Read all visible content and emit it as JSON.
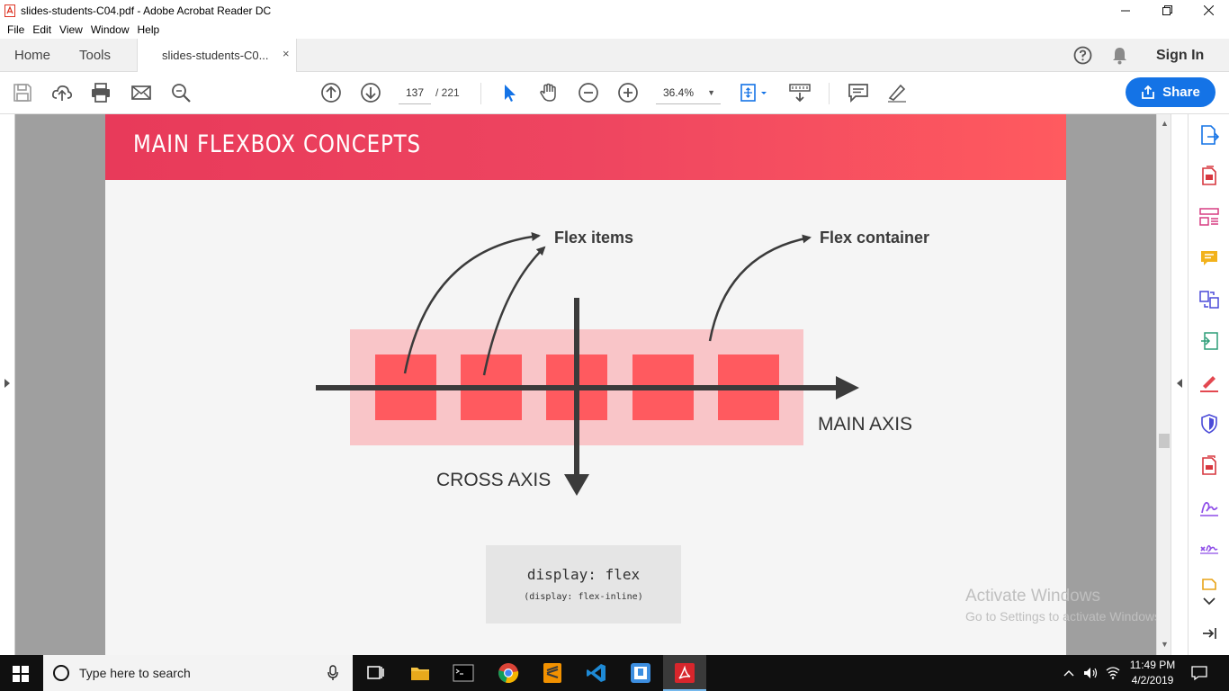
{
  "window": {
    "title": "slides-students-C04.pdf - Adobe Acrobat Reader DC",
    "controls": [
      "minimize",
      "restore",
      "close"
    ]
  },
  "menu": [
    "File",
    "Edit",
    "View",
    "Window",
    "Help"
  ],
  "tabs": {
    "home": "Home",
    "tools": "Tools",
    "document": "slides-students-C0...",
    "close_symbol": "×",
    "sign_in": "Sign In"
  },
  "toolbar": {
    "current_page": "137",
    "total_pages": "/ 221",
    "zoom": "36.4%",
    "share": "Share",
    "icons": [
      "save-icon",
      "upload-cloud-icon",
      "print-icon",
      "email-icon",
      "find-icon",
      "page-up-icon",
      "page-down-icon",
      "select-arrow-icon",
      "pan-hand-icon",
      "zoom-out-icon",
      "zoom-in-icon",
      "fit-page-icon",
      "read-mode-icon",
      "comment-icon",
      "sign-highlight-icon"
    ]
  },
  "slide": {
    "title": "MAIN FLEXBOX CONCEPTS",
    "flex_items_label": "Flex items",
    "flex_container_label": "Flex container",
    "main_axis_label": "MAIN AXIS",
    "cross_axis_label": "CROSS AXIS",
    "code_main": "display: flex",
    "code_sub": "(display: flex-inline)",
    "colors": {
      "header_start": "#e83a5a",
      "header_end": "#ff5a5f",
      "item": "#ff5a5f",
      "container": "#f9c5c8",
      "axis": "#3b3b3b"
    },
    "item_count": 5
  },
  "watermark": {
    "line1": "Activate Windows",
    "line2": "Go to Settings to activate Windows."
  },
  "right_panel_icons": [
    "export-pdf-icon",
    "create-pdf-icon",
    "organize-pages-icon",
    "comment-tool-icon",
    "combine-files-icon",
    "edit-pdf-icon",
    "fill-sign-icon",
    "protect-icon",
    "send-for-review-icon",
    "request-signature-icon",
    "certificates-icon",
    "more-tools-icon",
    "expand-chevron-icon",
    "collapse-panel-icon"
  ],
  "taskbar": {
    "search_placeholder": "Type here to search",
    "time": "11:49 PM",
    "date": "4/2/2019",
    "apps": [
      "task-view-icon",
      "file-explorer-icon",
      "terminal-icon",
      "chrome-icon",
      "sublime-icon",
      "vscode-icon",
      "app-icon",
      "acrobat-icon"
    ]
  }
}
